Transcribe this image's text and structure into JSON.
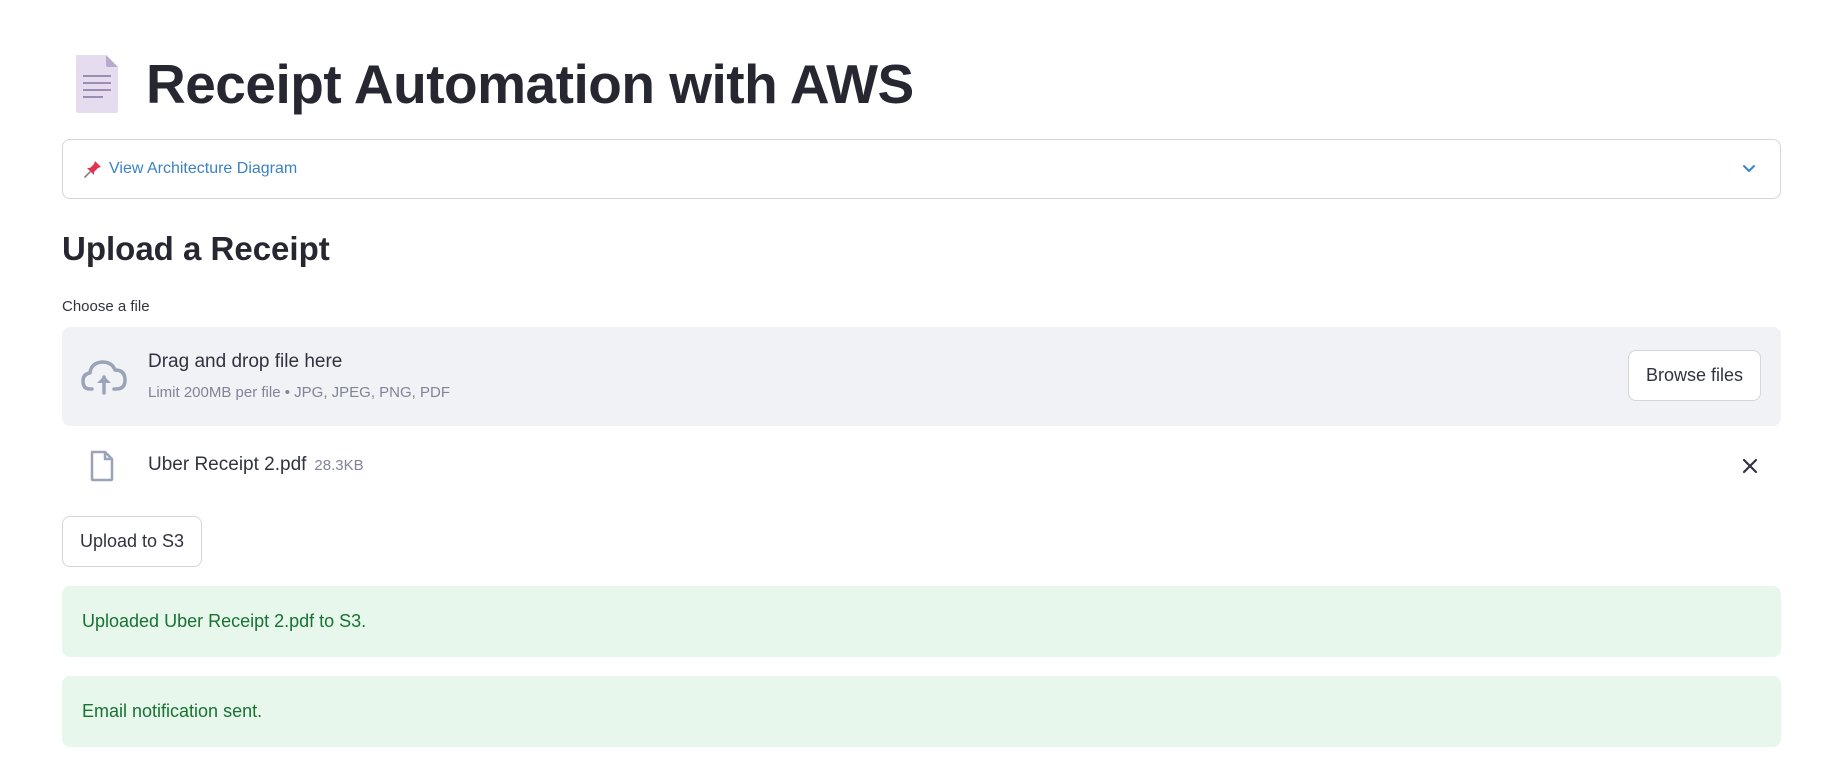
{
  "header": {
    "emoji_icon": "page-facing-up-icon",
    "title": "Receipt Automation with AWS"
  },
  "expander": {
    "icon": "pushpin-icon",
    "label": "View Architecture Diagram",
    "expanded": false
  },
  "upload_section": {
    "title": "Upload a Receipt",
    "field_label": "Choose a file",
    "dropzone": {
      "icon": "cloud-upload-icon",
      "title": "Drag and drop file here",
      "subtitle": "Limit 200MB per file • JPG, JPEG, PNG, PDF",
      "browse_label": "Browse files"
    },
    "uploaded_file": {
      "icon": "file-icon",
      "name": "Uber Receipt 2.pdf",
      "size": "28.3KB"
    },
    "upload_button_label": "Upload to S3"
  },
  "alerts": [
    {
      "type": "success",
      "message": "Uploaded Uber Receipt 2.pdf to S3."
    },
    {
      "type": "success",
      "message": "Email notification sent."
    }
  ],
  "colors": {
    "accent_link": "#3b82c4",
    "success_bg": "#e8f7ec",
    "success_text": "#177233",
    "dropzone_bg": "#f0f2f6"
  }
}
